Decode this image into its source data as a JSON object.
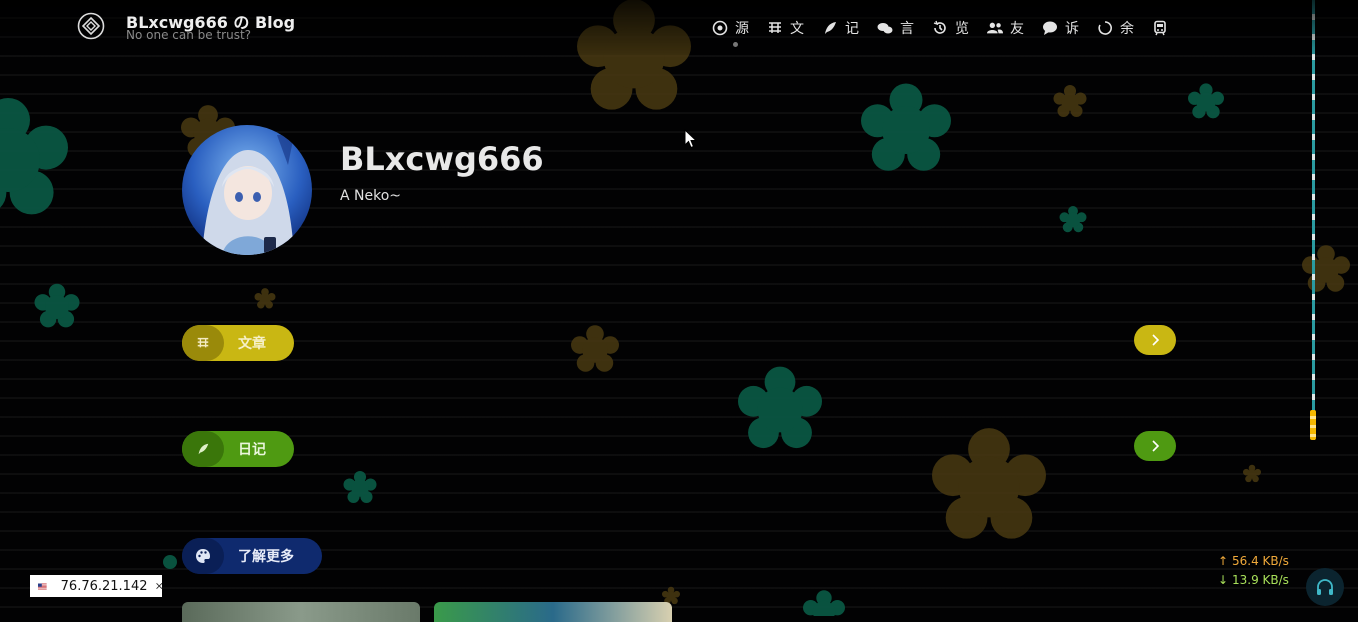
{
  "header": {
    "title": "BLxcwg666 の Blog",
    "subtitle": "No one can be trust?",
    "nav": [
      {
        "icon": "circle-dot-icon",
        "label": "源"
      },
      {
        "icon": "article-icon",
        "label": "文"
      },
      {
        "icon": "feather-icon",
        "label": "记"
      },
      {
        "icon": "comments-icon",
        "label": "言"
      },
      {
        "icon": "history-icon",
        "label": "览"
      },
      {
        "icon": "users-icon",
        "label": "友"
      },
      {
        "icon": "comment-icon",
        "label": "诉"
      },
      {
        "icon": "loading-circle-icon",
        "label": "余"
      },
      {
        "icon": "train-icon",
        "label": ""
      }
    ]
  },
  "profile": {
    "name": "BLxcwg666",
    "bio": "A Neko~"
  },
  "sections": [
    {
      "label": "文章",
      "icon": "article-icon",
      "color": "#c9b713",
      "icon_bg": "#9a8a0a"
    },
    {
      "label": "日记",
      "icon": "feather-icon",
      "color": "#4f9a12",
      "icon_bg": "#3a760a"
    },
    {
      "label": "了解更多",
      "icon": "palette-icon",
      "color": "#0f2a6e",
      "icon_bg": "#0a1f56"
    }
  ],
  "network": {
    "ip": "76.76.21.142",
    "upload": "56.4 KB/s",
    "download": "13.9 KB/s",
    "upload_color": "#f0a93a",
    "download_color": "#a8e05a"
  },
  "colors": {
    "accent_teal": "#0e6b54",
    "accent_brown": "#6b5218",
    "scroll_track": "#2a9aa0",
    "scroll_thumb": "#f5b800"
  }
}
